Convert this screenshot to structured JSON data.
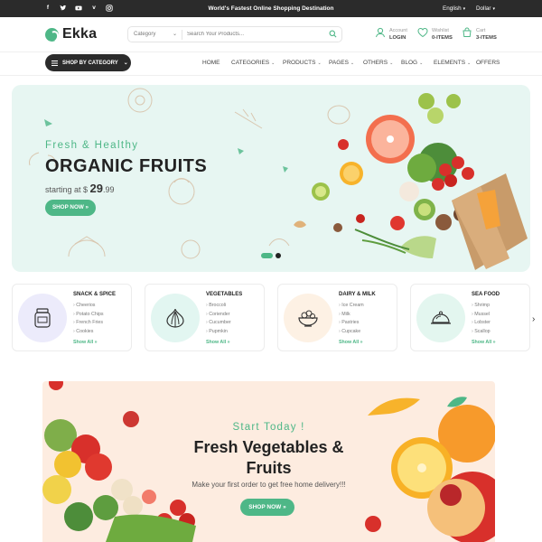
{
  "topbar": {
    "tagline": "World's Fastest Online Shopping Destination",
    "language": "English",
    "currency": "Dollar",
    "socials": [
      "facebook",
      "twitter",
      "youtube",
      "vimeo",
      "instagram"
    ]
  },
  "header": {
    "logo": "Ekka",
    "search": {
      "category": "Category",
      "placeholder": "Search Your Products..."
    },
    "account": {
      "label": "Account",
      "action": "LOGIN"
    },
    "wishlist": {
      "label": "Wishlist",
      "count": "0-ITEMS"
    },
    "cart": {
      "label": "Cart",
      "count": "3-ITEMS"
    }
  },
  "nav": {
    "shop_by_category": "SHOP BY CATEGORY",
    "items": [
      "HOME",
      "CATEGORIES",
      "PRODUCTS",
      "PAGES",
      "OTHERS",
      "BLOG",
      "ELEMENTS",
      "OFFERS"
    ]
  },
  "hero": {
    "kicker": "Fresh & Healthy",
    "title": "ORGANIC FRUITS",
    "starting": "starting at $",
    "price": "29",
    "cents": ".99",
    "button": "SHOP NOW »"
  },
  "categories": [
    {
      "title": "SNACK & SPICE",
      "items": [
        "Cheerios",
        "Potato Chips",
        "French Fries",
        "Cookies"
      ],
      "show_all": "Show All »",
      "icon": "jar-icon",
      "color": "#ecebfb"
    },
    {
      "title": "VEGETABLES",
      "items": [
        "Broccoli",
        "Coriender",
        "Cucumber",
        "Pupmkin"
      ],
      "show_all": "Show All »",
      "icon": "onion-icon",
      "color": "#e2f6f1"
    },
    {
      "title": "DAIRY & MILK",
      "items": [
        "Ice Cream",
        "Milk",
        "Pastries",
        "Cupcake"
      ],
      "show_all": "Show All »",
      "icon": "bowl-icon",
      "color": "#fdf1e4"
    },
    {
      "title": "SEA FOOD",
      "items": [
        "Shrimp",
        "Mussel",
        "Lobster",
        "Scallop"
      ],
      "show_all": "Show All »",
      "icon": "cloche-icon",
      "color": "#e3f6ef"
    }
  ],
  "banner": {
    "kicker": "Start Today !",
    "title_line1": "Fresh Vegetables &",
    "title_line2": "Fruits",
    "description": "Make your first order to get free home delivery!!!",
    "button": "SHOP NOW »"
  },
  "colors": {
    "accent": "#4eb787",
    "dark": "#2b2b2b",
    "hero_bg": "#e7f6f2",
    "banner_bg": "#fdece0"
  }
}
